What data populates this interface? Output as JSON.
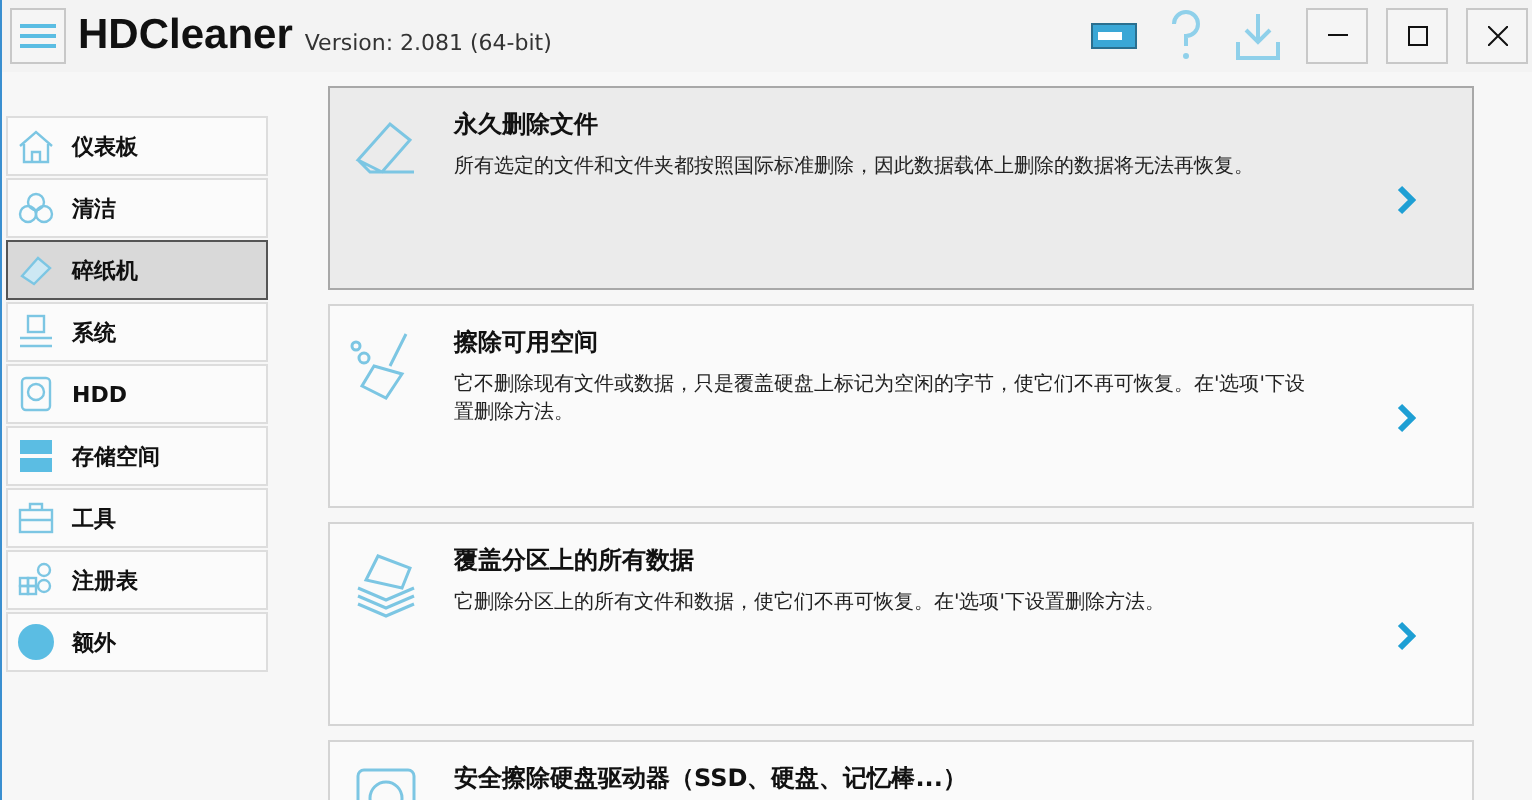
{
  "window": {
    "title": "HDCleaner",
    "version": "Version: 2.081 (64-bit)"
  },
  "sidebar": {
    "items": [
      {
        "label": "仪表板",
        "selected": false
      },
      {
        "label": "清洁",
        "selected": false
      },
      {
        "label": "碎纸机",
        "selected": true
      },
      {
        "label": "系统",
        "selected": false
      },
      {
        "label": "HDD",
        "selected": false
      },
      {
        "label": "存储空间",
        "selected": false
      },
      {
        "label": "工具",
        "selected": false
      },
      {
        "label": "注册表",
        "selected": false
      },
      {
        "label": "额外",
        "selected": false
      }
    ]
  },
  "cards": [
    {
      "title": "永久删除文件",
      "description": "所有选定的文件和文件夹都按照国际标准删除，因此数据载体上删除的数据将无法再恢复。",
      "selected": true
    },
    {
      "title": "擦除可用空间",
      "description": "它不删除现有文件或数据，只是覆盖硬盘上标记为空闲的字节，使它们不再可恢复。在'选项'下设置删除方法。",
      "selected": false
    },
    {
      "title": "覆盖分区上的所有数据",
      "description": "它删除分区上的所有文件和数据，使它们不再可恢复。在'选项'下设置删除方法。",
      "selected": false
    },
    {
      "title": "安全擦除硬盘驱动器（SSD、硬盘、记忆棒...）",
      "selected": false
    }
  ]
}
